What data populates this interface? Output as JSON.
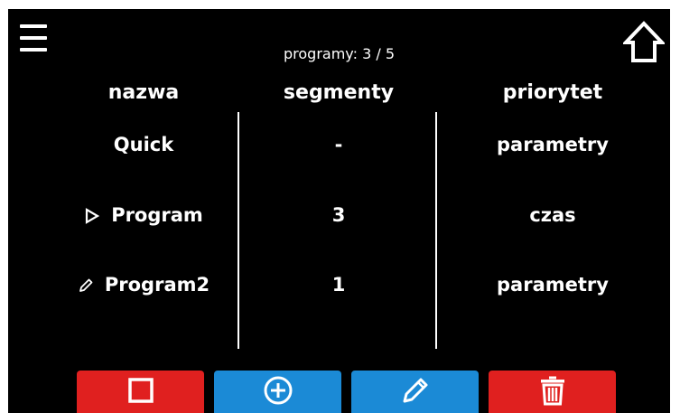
{
  "header": {
    "program_count_label": "programy:",
    "program_count_value": "3 / 5"
  },
  "columns": {
    "name": "nazwa",
    "segments": "segmenty",
    "priority": "priorytet"
  },
  "programs": [
    {
      "name": "Quick",
      "segments": "-",
      "priority": "parametry",
      "icon": ""
    },
    {
      "name": "Program",
      "segments": "3",
      "priority": "czas",
      "icon": "play-outline-icon"
    },
    {
      "name": "Program2",
      "segments": "1",
      "priority": "parametry",
      "icon": "pencil-icon"
    }
  ],
  "toolbar": {
    "buttons": [
      {
        "name": "stop",
        "icon": "square-stop-icon",
        "color": "#e0201f"
      },
      {
        "name": "add",
        "icon": "plus-circle-icon",
        "color": "#1b8ad6"
      },
      {
        "name": "edit",
        "icon": "pencil-icon",
        "color": "#1b8ad6"
      },
      {
        "name": "delete",
        "icon": "trash-icon",
        "color": "#e0201f"
      }
    ]
  },
  "colors": {
    "background": "#000000",
    "text": "#ffffff",
    "danger": "#e0201f",
    "primary": "#1b8ad6"
  }
}
